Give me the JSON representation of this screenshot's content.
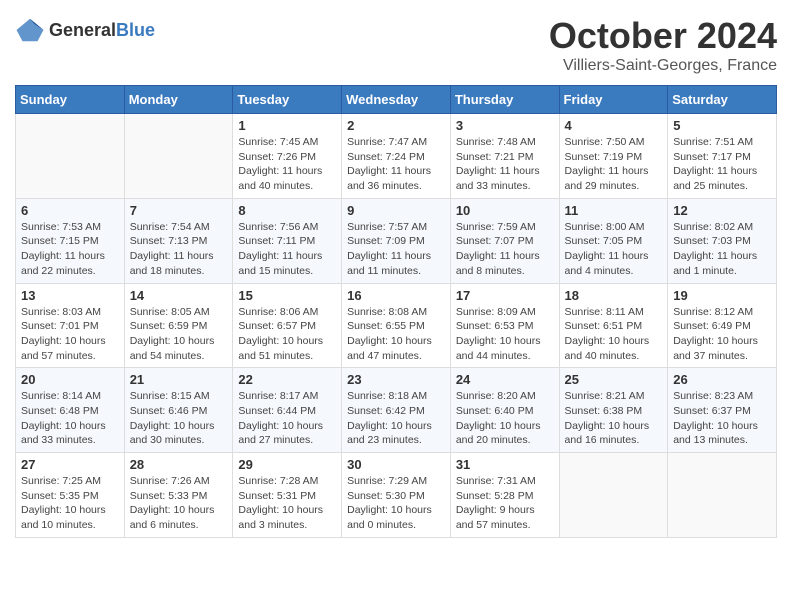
{
  "header": {
    "logo": {
      "general": "General",
      "blue": "Blue"
    },
    "month": "October 2024",
    "location": "Villiers-Saint-Georges, France"
  },
  "weekdays": [
    "Sunday",
    "Monday",
    "Tuesday",
    "Wednesday",
    "Thursday",
    "Friday",
    "Saturday"
  ],
  "weeks": [
    [
      {
        "day": "",
        "sunrise": "",
        "sunset": "",
        "daylight": ""
      },
      {
        "day": "",
        "sunrise": "",
        "sunset": "",
        "daylight": ""
      },
      {
        "day": "1",
        "sunrise": "Sunrise: 7:45 AM",
        "sunset": "Sunset: 7:26 PM",
        "daylight": "Daylight: 11 hours and 40 minutes."
      },
      {
        "day": "2",
        "sunrise": "Sunrise: 7:47 AM",
        "sunset": "Sunset: 7:24 PM",
        "daylight": "Daylight: 11 hours and 36 minutes."
      },
      {
        "day": "3",
        "sunrise": "Sunrise: 7:48 AM",
        "sunset": "Sunset: 7:21 PM",
        "daylight": "Daylight: 11 hours and 33 minutes."
      },
      {
        "day": "4",
        "sunrise": "Sunrise: 7:50 AM",
        "sunset": "Sunset: 7:19 PM",
        "daylight": "Daylight: 11 hours and 29 minutes."
      },
      {
        "day": "5",
        "sunrise": "Sunrise: 7:51 AM",
        "sunset": "Sunset: 7:17 PM",
        "daylight": "Daylight: 11 hours and 25 minutes."
      }
    ],
    [
      {
        "day": "6",
        "sunrise": "Sunrise: 7:53 AM",
        "sunset": "Sunset: 7:15 PM",
        "daylight": "Daylight: 11 hours and 22 minutes."
      },
      {
        "day": "7",
        "sunrise": "Sunrise: 7:54 AM",
        "sunset": "Sunset: 7:13 PM",
        "daylight": "Daylight: 11 hours and 18 minutes."
      },
      {
        "day": "8",
        "sunrise": "Sunrise: 7:56 AM",
        "sunset": "Sunset: 7:11 PM",
        "daylight": "Daylight: 11 hours and 15 minutes."
      },
      {
        "day": "9",
        "sunrise": "Sunrise: 7:57 AM",
        "sunset": "Sunset: 7:09 PM",
        "daylight": "Daylight: 11 hours and 11 minutes."
      },
      {
        "day": "10",
        "sunrise": "Sunrise: 7:59 AM",
        "sunset": "Sunset: 7:07 PM",
        "daylight": "Daylight: 11 hours and 8 minutes."
      },
      {
        "day": "11",
        "sunrise": "Sunrise: 8:00 AM",
        "sunset": "Sunset: 7:05 PM",
        "daylight": "Daylight: 11 hours and 4 minutes."
      },
      {
        "day": "12",
        "sunrise": "Sunrise: 8:02 AM",
        "sunset": "Sunset: 7:03 PM",
        "daylight": "Daylight: 11 hours and 1 minute."
      }
    ],
    [
      {
        "day": "13",
        "sunrise": "Sunrise: 8:03 AM",
        "sunset": "Sunset: 7:01 PM",
        "daylight": "Daylight: 10 hours and 57 minutes."
      },
      {
        "day": "14",
        "sunrise": "Sunrise: 8:05 AM",
        "sunset": "Sunset: 6:59 PM",
        "daylight": "Daylight: 10 hours and 54 minutes."
      },
      {
        "day": "15",
        "sunrise": "Sunrise: 8:06 AM",
        "sunset": "Sunset: 6:57 PM",
        "daylight": "Daylight: 10 hours and 51 minutes."
      },
      {
        "day": "16",
        "sunrise": "Sunrise: 8:08 AM",
        "sunset": "Sunset: 6:55 PM",
        "daylight": "Daylight: 10 hours and 47 minutes."
      },
      {
        "day": "17",
        "sunrise": "Sunrise: 8:09 AM",
        "sunset": "Sunset: 6:53 PM",
        "daylight": "Daylight: 10 hours and 44 minutes."
      },
      {
        "day": "18",
        "sunrise": "Sunrise: 8:11 AM",
        "sunset": "Sunset: 6:51 PM",
        "daylight": "Daylight: 10 hours and 40 minutes."
      },
      {
        "day": "19",
        "sunrise": "Sunrise: 8:12 AM",
        "sunset": "Sunset: 6:49 PM",
        "daylight": "Daylight: 10 hours and 37 minutes."
      }
    ],
    [
      {
        "day": "20",
        "sunrise": "Sunrise: 8:14 AM",
        "sunset": "Sunset: 6:48 PM",
        "daylight": "Daylight: 10 hours and 33 minutes."
      },
      {
        "day": "21",
        "sunrise": "Sunrise: 8:15 AM",
        "sunset": "Sunset: 6:46 PM",
        "daylight": "Daylight: 10 hours and 30 minutes."
      },
      {
        "day": "22",
        "sunrise": "Sunrise: 8:17 AM",
        "sunset": "Sunset: 6:44 PM",
        "daylight": "Daylight: 10 hours and 27 minutes."
      },
      {
        "day": "23",
        "sunrise": "Sunrise: 8:18 AM",
        "sunset": "Sunset: 6:42 PM",
        "daylight": "Daylight: 10 hours and 23 minutes."
      },
      {
        "day": "24",
        "sunrise": "Sunrise: 8:20 AM",
        "sunset": "Sunset: 6:40 PM",
        "daylight": "Daylight: 10 hours and 20 minutes."
      },
      {
        "day": "25",
        "sunrise": "Sunrise: 8:21 AM",
        "sunset": "Sunset: 6:38 PM",
        "daylight": "Daylight: 10 hours and 16 minutes."
      },
      {
        "day": "26",
        "sunrise": "Sunrise: 8:23 AM",
        "sunset": "Sunset: 6:37 PM",
        "daylight": "Daylight: 10 hours and 13 minutes."
      }
    ],
    [
      {
        "day": "27",
        "sunrise": "Sunrise: 7:25 AM",
        "sunset": "Sunset: 5:35 PM",
        "daylight": "Daylight: 10 hours and 10 minutes."
      },
      {
        "day": "28",
        "sunrise": "Sunrise: 7:26 AM",
        "sunset": "Sunset: 5:33 PM",
        "daylight": "Daylight: 10 hours and 6 minutes."
      },
      {
        "day": "29",
        "sunrise": "Sunrise: 7:28 AM",
        "sunset": "Sunset: 5:31 PM",
        "daylight": "Daylight: 10 hours and 3 minutes."
      },
      {
        "day": "30",
        "sunrise": "Sunrise: 7:29 AM",
        "sunset": "Sunset: 5:30 PM",
        "daylight": "Daylight: 10 hours and 0 minutes."
      },
      {
        "day": "31",
        "sunrise": "Sunrise: 7:31 AM",
        "sunset": "Sunset: 5:28 PM",
        "daylight": "Daylight: 9 hours and 57 minutes."
      },
      {
        "day": "",
        "sunrise": "",
        "sunset": "",
        "daylight": ""
      },
      {
        "day": "",
        "sunrise": "",
        "sunset": "",
        "daylight": ""
      }
    ]
  ]
}
